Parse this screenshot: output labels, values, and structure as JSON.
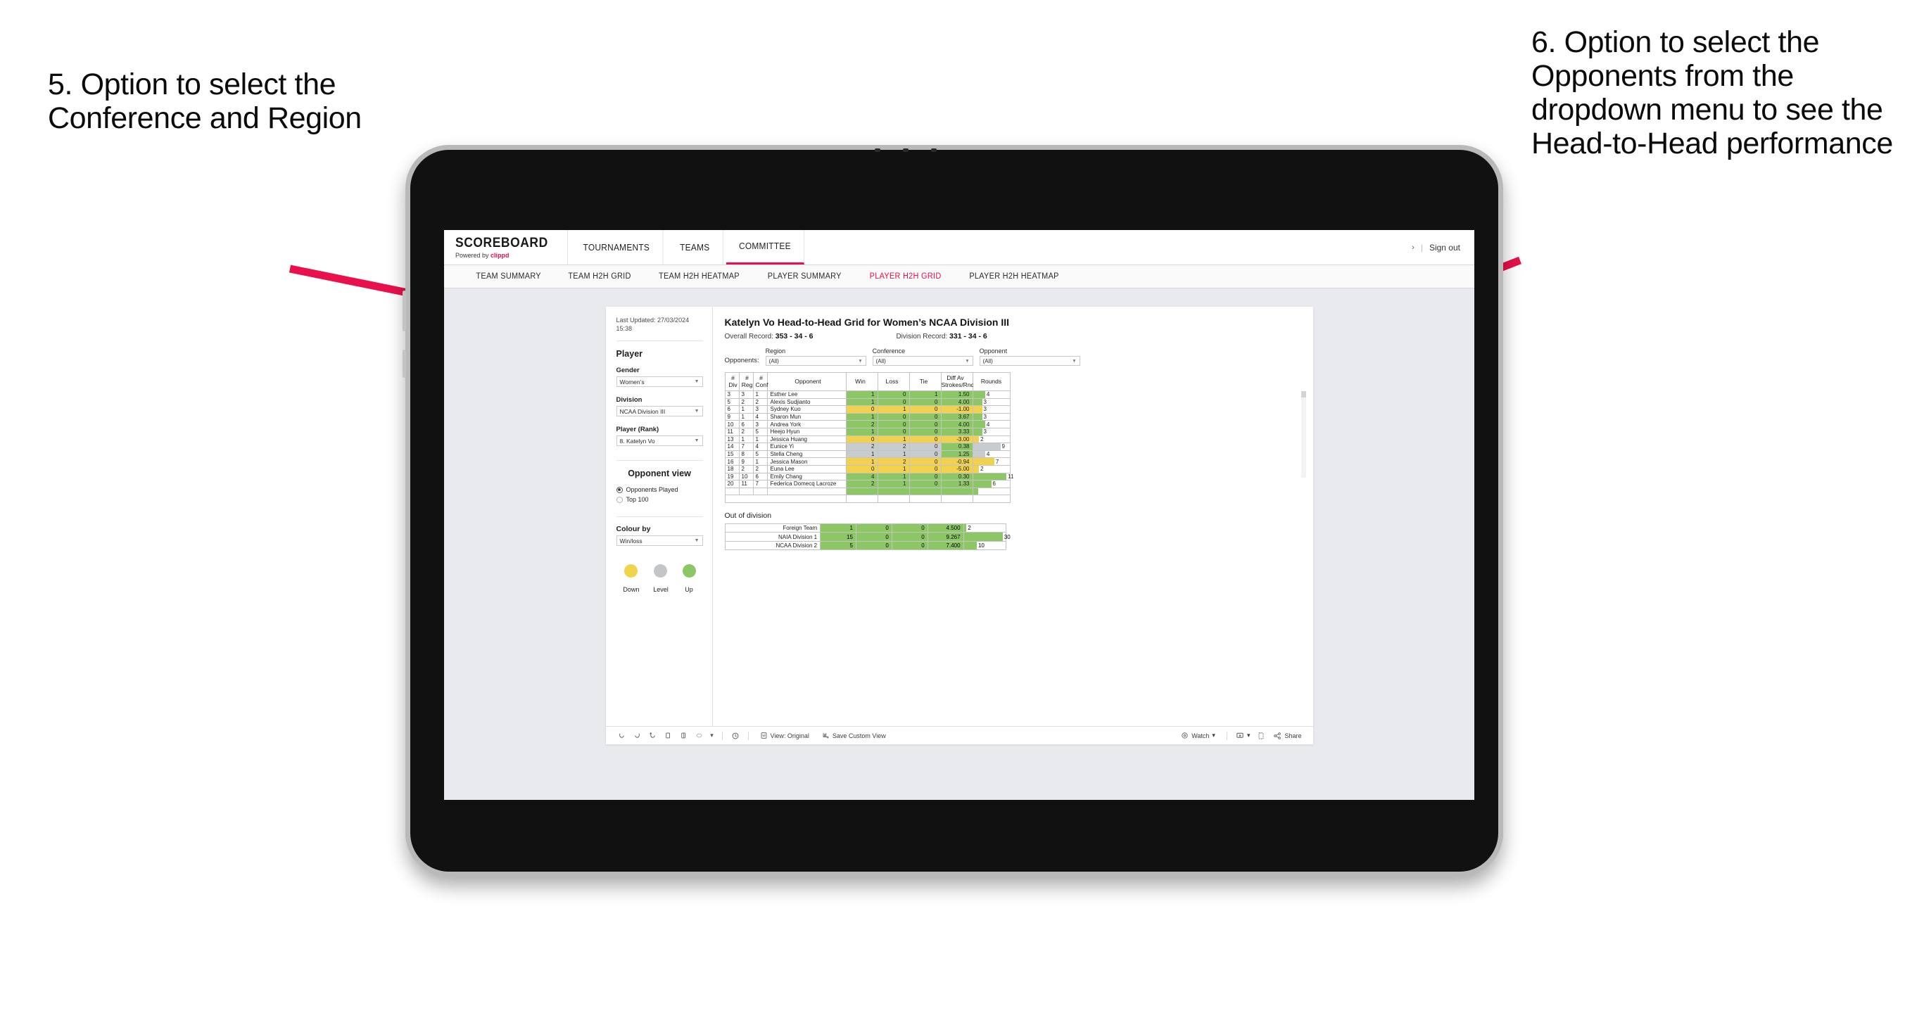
{
  "annotations": {
    "left": "5. Option to select the Conference and Region",
    "right": "6. Option to select the Opponents from the dropdown menu to see the Head-to-Head performance",
    "arrow_color": "#E8114B"
  },
  "app": {
    "brand_title": "SCOREBOARD",
    "brand_powered": "Powered by",
    "brand_name": "clippd",
    "top_nav": [
      "TOURNAMENTS",
      "TEAMS",
      "COMMITTEE"
    ],
    "top_nav_active": "COMMITTEE",
    "sign_out": "Sign out",
    "sign_out_chevron": "›",
    "sign_out_divider": "|",
    "sub_nav": [
      "TEAM SUMMARY",
      "TEAM H2H GRID",
      "TEAM H2H HEATMAP",
      "PLAYER SUMMARY",
      "PLAYER H2H GRID",
      "PLAYER H2H HEATMAP"
    ],
    "sub_nav_active": "PLAYER H2H GRID"
  },
  "sidebar": {
    "last_updated": "Last Updated: 27/03/2024 15:38",
    "player_heading": "Player",
    "fields": [
      {
        "label": "Gender",
        "value": "Women’s"
      },
      {
        "label": "Division",
        "value": "NCAA Division III"
      },
      {
        "label": "Player (Rank)",
        "value": "8. Katelyn Vo"
      }
    ],
    "opponent_view_heading": "Opponent view",
    "opponent_view_options": [
      {
        "label": "Opponents Played",
        "selected": true
      },
      {
        "label": "Top 100",
        "selected": false
      }
    ],
    "colour_by_label": "Colour by",
    "colour_by_value": "Win/loss",
    "legend": [
      {
        "label": "Down",
        "color": "#F0D44B"
      },
      {
        "label": "Level",
        "color": "#C3C6C9"
      },
      {
        "label": "Up",
        "color": "#8CC665"
      }
    ]
  },
  "viz": {
    "title": "Katelyn Vo Head-to-Head Grid for Women’s NCAA Division III",
    "overall_record_label": "Overall Record:",
    "overall_record_value": "353 -  34 - 6",
    "division_record_label": "Division Record:",
    "division_record_value": "331 -  34 - 6",
    "opponents_label": "Opponents:",
    "filters": [
      {
        "label": "Region",
        "value": "(All)"
      },
      {
        "label": "Conference",
        "value": "(All)"
      },
      {
        "label": "Opponent",
        "value": "(All)"
      }
    ],
    "out_of_division_title": "Out of division"
  },
  "chart_data": {
    "type": "table",
    "title": "Katelyn Vo Head-to-Head Grid for Women’s NCAA Division III",
    "columns": [
      "# Div",
      "# Reg",
      "# Conf",
      "Opponent",
      "Win",
      "Loss",
      "Tie",
      "Diff Av Strokes/Rnd",
      "Rounds"
    ],
    "column_header_lines": [
      [
        "#",
        "Div"
      ],
      [
        "#",
        "Reg"
      ],
      [
        "#",
        "Conf"
      ],
      [
        "Opponent"
      ],
      [
        "Win"
      ],
      [
        "Loss"
      ],
      [
        "Tie"
      ],
      [
        "Diff Av",
        "Strokes/Rnd"
      ],
      [
        "Rounds"
      ]
    ],
    "rows": [
      {
        "div": "3",
        "reg": "3",
        "conf": "1",
        "opponent": "Esther Lee",
        "win": "1",
        "loss": "0",
        "tie": "1",
        "diff": "1.50",
        "rounds": "4",
        "state": "up"
      },
      {
        "div": "5",
        "reg": "2",
        "conf": "2",
        "opponent": "Alexis Sudjianto",
        "win": "1",
        "loss": "0",
        "tie": "0",
        "diff": "4.00",
        "rounds": "3",
        "state": "up"
      },
      {
        "div": "6",
        "reg": "1",
        "conf": "3",
        "opponent": "Sydney Kuo",
        "win": "0",
        "loss": "1",
        "tie": "0",
        "diff": "-1.00",
        "rounds": "3",
        "state": "down"
      },
      {
        "div": "9",
        "reg": "1",
        "conf": "4",
        "opponent": "Sharon Mun",
        "win": "1",
        "loss": "0",
        "tie": "0",
        "diff": "3.67",
        "rounds": "3",
        "state": "up"
      },
      {
        "div": "10",
        "reg": "6",
        "conf": "3",
        "opponent": "Andrea York",
        "win": "2",
        "loss": "0",
        "tie": "0",
        "diff": "4.00",
        "rounds": "4",
        "state": "up"
      },
      {
        "div": "11",
        "reg": "2",
        "conf": "5",
        "opponent": "Heejo Hyun",
        "win": "1",
        "loss": "0",
        "tie": "0",
        "diff": "3.33",
        "rounds": "3",
        "state": "up"
      },
      {
        "div": "13",
        "reg": "1",
        "conf": "1",
        "opponent": "Jessica Huang",
        "win": "0",
        "loss": "1",
        "tie": "0",
        "diff": "-3.00",
        "rounds": "2",
        "state": "down"
      },
      {
        "div": "14",
        "reg": "7",
        "conf": "4",
        "opponent": "Eunice Yi",
        "win": "2",
        "loss": "2",
        "tie": "0",
        "diff": "0.38",
        "rounds": "9",
        "state": "level",
        "diff_state": "up"
      },
      {
        "div": "15",
        "reg": "8",
        "conf": "5",
        "opponent": "Stella Cheng",
        "win": "1",
        "loss": "1",
        "tie": "0",
        "diff": "1.25",
        "rounds": "4",
        "state": "level",
        "diff_state": "up"
      },
      {
        "div": "16",
        "reg": "9",
        "conf": "1",
        "opponent": "Jessica Mason",
        "win": "1",
        "loss": "2",
        "tie": "0",
        "diff": "-0.94",
        "rounds": "7",
        "state": "down"
      },
      {
        "div": "18",
        "reg": "2",
        "conf": "2",
        "opponent": "Euna Lee",
        "win": "0",
        "loss": "1",
        "tie": "0",
        "diff": "-5.00",
        "rounds": "2",
        "state": "down"
      },
      {
        "div": "19",
        "reg": "10",
        "conf": "6",
        "opponent": "Emily Chang",
        "win": "4",
        "loss": "1",
        "tie": "0",
        "diff": "0.30",
        "rounds": "11",
        "state": "up"
      },
      {
        "div": "20",
        "reg": "11",
        "conf": "7",
        "opponent": "Federica Domecq Lacroze",
        "win": "2",
        "loss": "1",
        "tie": "0",
        "diff": "1.33",
        "rounds": "6",
        "state": "up"
      }
    ],
    "rounds_max": 12,
    "out_of_division": {
      "title": "Out of division",
      "rows": [
        {
          "name": "Foreign Team",
          "win": "1",
          "loss": "0",
          "tie": "0",
          "diff": "4.500",
          "rounds": "2",
          "state": "up"
        },
        {
          "name": "NAIA Division 1",
          "win": "15",
          "loss": "0",
          "tie": "0",
          "diff": "9.267",
          "rounds": "30",
          "state": "up"
        },
        {
          "name": "NCAA Division 2",
          "win": "5",
          "loss": "0",
          "tie": "0",
          "diff": "7.400",
          "rounds": "10",
          "state": "up"
        }
      ],
      "rounds_max": 32
    },
    "colors": {
      "up": "#8CC665",
      "down": "#F2D14E",
      "level": "#C9CCCF",
      "neutral": "#FFFFFF"
    }
  },
  "toolbar": {
    "view_label": "View: Original",
    "save_label": "Save Custom View",
    "watch_label": "Watch",
    "share_label": "Share",
    "caret": "▾"
  }
}
